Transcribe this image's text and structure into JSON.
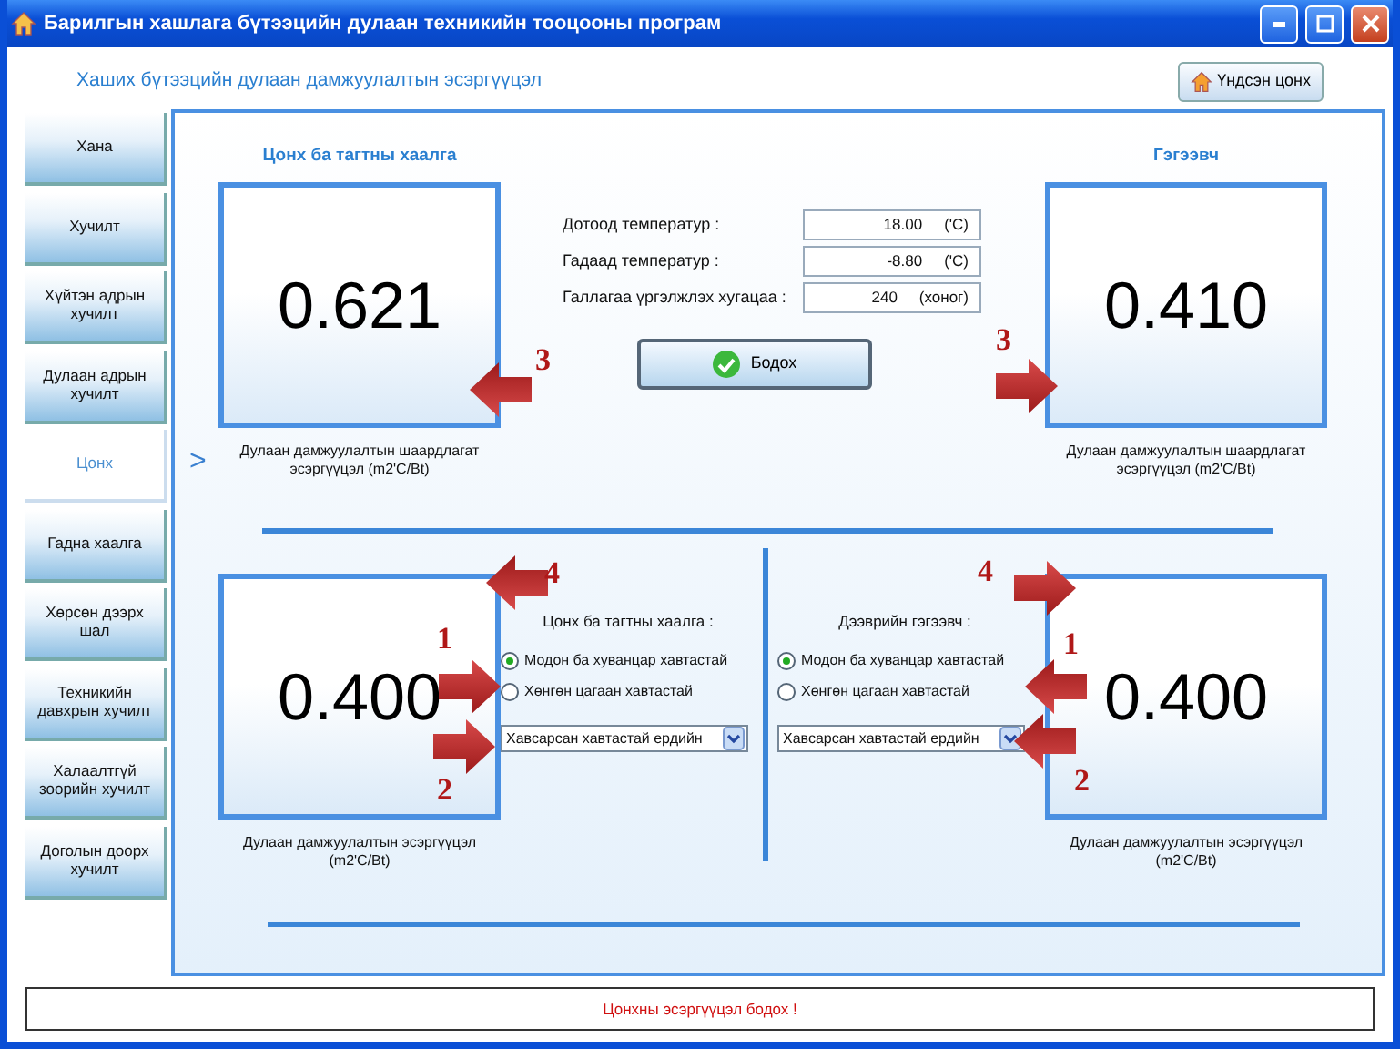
{
  "window": {
    "title": "Барилгын хашлага бүтээцийн дулаан техникийн тооцооны програм"
  },
  "header": {
    "title": "Хаших бүтээцийн дулаан дамжуулалтын эсэргүүцэл",
    "home_button": "Үндсэн цонх"
  },
  "sidebar": {
    "items": [
      {
        "label": "Хана",
        "selected": false
      },
      {
        "label": "Хучилт",
        "selected": false
      },
      {
        "label": "Хүйтэн адрын хучилт",
        "selected": false
      },
      {
        "label": "Дулаан адрын хучилт",
        "selected": false
      },
      {
        "label": "Цонх",
        "selected": true
      },
      {
        "label": "Гадна хаалга",
        "selected": false
      },
      {
        "label": "Хөрсөн дээрх шал",
        "selected": false
      },
      {
        "label": "Техникийн давхрын хучилт",
        "selected": false
      },
      {
        "label": "Халаалтгүй зоорийн хучилт",
        "selected": false
      },
      {
        "label": "Доголын доорх хучилт",
        "selected": false
      }
    ]
  },
  "pointer": ">",
  "top": {
    "left_result": {
      "title": "Цонх ба тагтны хаалга",
      "value": "0.621",
      "caption": "Дулаан дамжуулалтын шаардлагат эсэргүүцэл (m2'C/Bt)"
    },
    "inputs": [
      {
        "label": "Дотоод температур :",
        "value": "18.00",
        "unit": "('C)"
      },
      {
        "label": "Гадаад температур :",
        "value": "-8.80",
        "unit": "('C)"
      },
      {
        "label": "Галлагаа үргэлжлэх хугацаа :",
        "value": "240",
        "unit": "(хоног)"
      }
    ],
    "calculate_button": "Бодох",
    "right_result": {
      "title": "Гэгээвч",
      "value": "0.410",
      "caption": "Дулаан дамжуулалтын шаардлагат эсэргүүцэл (m2'C/Bt)"
    }
  },
  "bottom": [
    {
      "group_label": "Цонх ба тагтны хаалга :",
      "options": [
        {
          "label": "Модон ба хуванцар хавтастай",
          "selected": true
        },
        {
          "label": "Хөнгөн цагаан хавтастай",
          "selected": false
        }
      ],
      "dropdown": "Хавсарсан хавтастай ердийн",
      "value": "0.400",
      "caption": "Дулаан дамжуулалтын эсэргүүцэл (m2'C/Bt)"
    },
    {
      "group_label": "Дээврийн гэгээвч :",
      "options": [
        {
          "label": "Модон ба хуванцар хавтастай",
          "selected": true
        },
        {
          "label": "Хөнгөн цагаан хавтастай",
          "selected": false
        }
      ],
      "dropdown": "Хавсарсан хавтастай ердийн",
      "value": "0.400",
      "caption": "Дулаан дамжуулалтын эсэргүүцэл (m2'C/Bt)"
    }
  ],
  "status_message": "Цонхны эсэргүүцэл бодох !",
  "annotations": [
    {
      "number": "3",
      "kind": "arrow-left"
    },
    {
      "number": "3",
      "kind": "arrow-right"
    },
    {
      "number": "4",
      "kind": "arrow-left"
    },
    {
      "number": "1",
      "kind": "arrow-right"
    },
    {
      "number": "2",
      "kind": "arrow-right"
    },
    {
      "number": "4",
      "kind": "arrow-right"
    },
    {
      "number": "1",
      "kind": "arrow-left"
    },
    {
      "number": "2",
      "kind": "arrow-left"
    }
  ]
}
